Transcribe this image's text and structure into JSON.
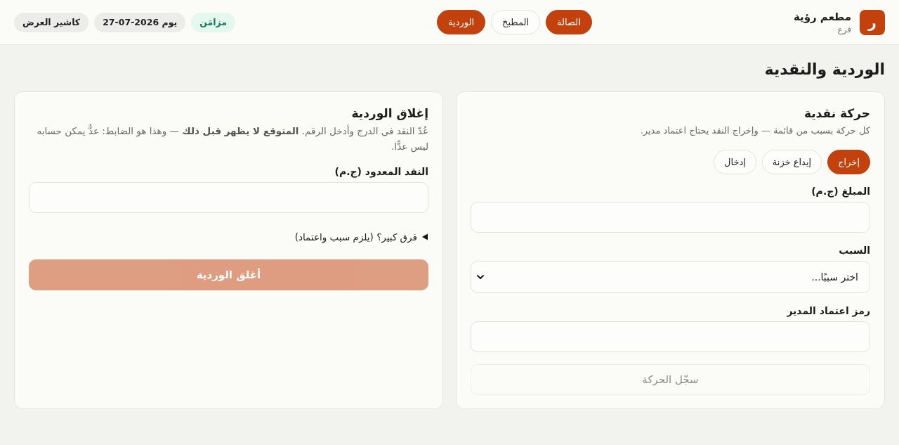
{
  "header": {
    "logo_letter": "ر",
    "brand": {
      "name": "مطعم رؤية",
      "branch": "فرع"
    },
    "nav": [
      {
        "label": "الصالة",
        "selected": true
      },
      {
        "label": "المطبخ",
        "selected": false
      },
      {
        "label": "الوردية",
        "selected": true
      }
    ],
    "chips": [
      {
        "label": "مزامَن",
        "kind": "status"
      },
      {
        "label": "يوم 2026-07-27",
        "kind": "info"
      },
      {
        "label": "كاشير العرض",
        "kind": "info"
      }
    ]
  },
  "page_title": "الوردية والنقدية",
  "cash_movement": {
    "title": "حركة نقدية",
    "description": "كل حركة بسبب من قائمة — وإخراج النقد يحتاج اعتماد مدير.",
    "movement_types": [
      {
        "label": "إخراج",
        "selected": true
      },
      {
        "label": "إيداع خزنة",
        "selected": false
      },
      {
        "label": "إدخال",
        "selected": false
      }
    ],
    "fields": [
      {
        "kind": "input",
        "label": "المبلغ (ج.م)"
      },
      {
        "kind": "select",
        "label": "السبب",
        "value": "اختر سببًا..."
      },
      {
        "kind": "input",
        "label": "رمز اعتماد المدير"
      }
    ],
    "submit": {
      "label": "سجّل الحركة",
      "kind": "secondary",
      "disabled": true
    }
  },
  "close_shift": {
    "title": "إغلاق الوردية",
    "description": "عُدّ النقد في الدرج وأدخل الرقم. **المتوقع لا يظهر قبل ذلك** — وهذا هو الضابط: عدٌّ يمكن حسابه ليس عدًّا.",
    "fields": [
      {
        "kind": "input",
        "label": "النقد المعدود (ج.م)"
      }
    ],
    "details": {
      "summary": "فرق كبير؟ (يلزم سبب واعتماد)",
      "expanded": false
    },
    "submit": {
      "label": "أغلق الوردية",
      "kind": "primary",
      "disabled": true
    }
  }
}
